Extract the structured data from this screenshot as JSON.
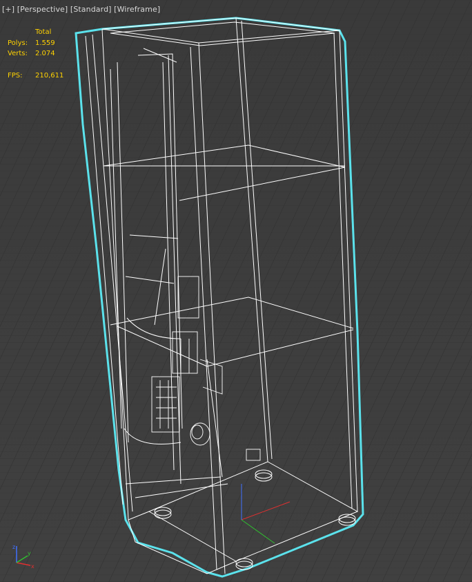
{
  "viewport": {
    "label_parts": [
      "[+]",
      "[Perspective]",
      "[Standard]",
      "[Wireframe]"
    ],
    "label_menu": "viewport-plus-menu",
    "colors": {
      "background": "#3d3d3d",
      "grid": "#2e2e2e",
      "wireframe": "#ffffff",
      "selection": "#5be2ec",
      "stats_text": "#ffd200",
      "axis_x": "#e03030",
      "axis_y": "#30c030",
      "axis_z": "#4070ff"
    }
  },
  "stats": {
    "header": "Total",
    "polys_label": "Polys:",
    "polys_value": "1.559",
    "verts_label": "Verts:",
    "verts_value": "2.074",
    "fps_label": "FPS:",
    "fps_value": "210,611"
  },
  "gizmo": {
    "icon": "xyz-axis-icon"
  }
}
